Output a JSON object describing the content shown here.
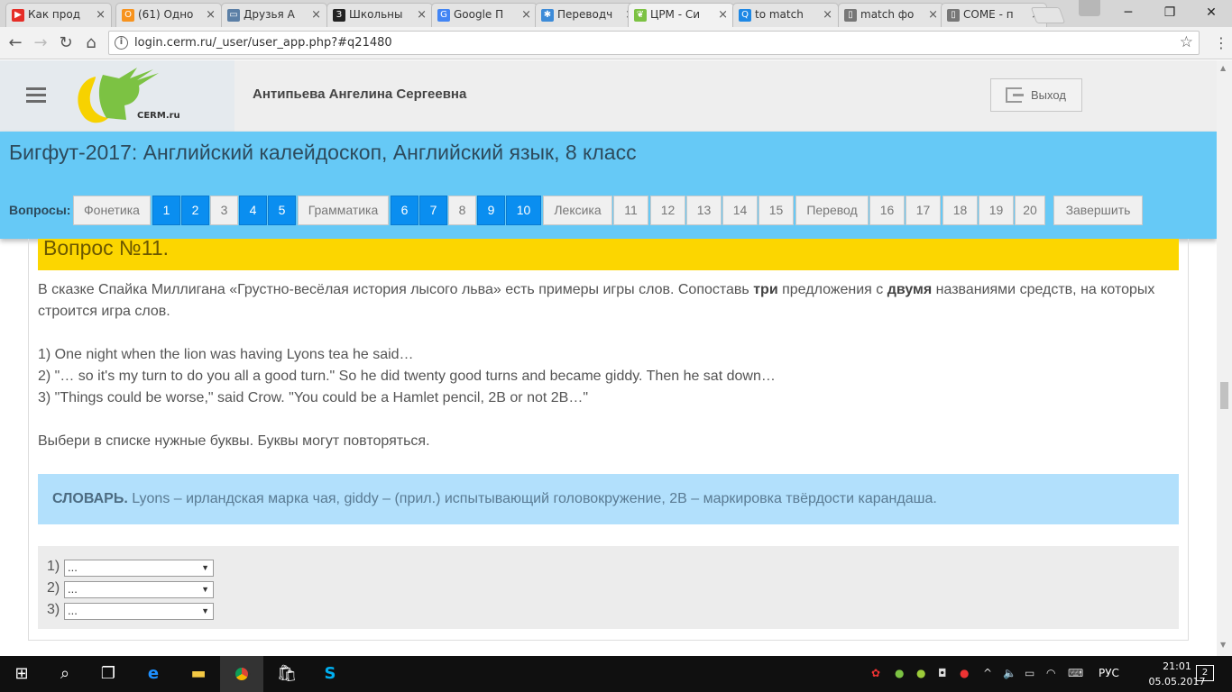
{
  "browser": {
    "tabs": [
      {
        "label": "Как прод",
        "icon": "youtube-icon",
        "color": "#e52d27"
      },
      {
        "label": "(61) Одно",
        "icon": "odnoklassniki-icon",
        "color": "#f7931e"
      },
      {
        "label": "Друзья А",
        "icon": "chat-icon",
        "color": "#5b7fa6"
      },
      {
        "label": "Школьны",
        "icon": "book-icon",
        "color": "#222222"
      },
      {
        "label": "Google П",
        "icon": "google-translate-icon",
        "color": "#4285f4"
      },
      {
        "label": "Переводч",
        "icon": "translate-icon",
        "color": "#3d8bd8"
      },
      {
        "label": "ЦРМ - Си",
        "icon": "cerm-icon",
        "color": "#7cc243"
      },
      {
        "label": "to match",
        "icon": "search-icon",
        "color": "#1e88e5"
      },
      {
        "label": "match фо",
        "icon": "document-icon",
        "color": "#777777"
      },
      {
        "label": "COME - п",
        "icon": "document-icon",
        "color": "#777777"
      }
    ],
    "url": "login.cerm.ru/_user/user_app.php?#q21480",
    "window_controls": {
      "minimize": "─",
      "maximize": "❐",
      "close": "✕"
    }
  },
  "header": {
    "logo_text": "CERM.ru",
    "username": "Антипьева Ангелина Сергеевна",
    "logout_label": "Выход"
  },
  "course": {
    "title": "Бигфут-2017: Английский калейдоскоп, Английский язык, 8 класс",
    "questions_label": "Вопросы:",
    "buttons": [
      {
        "label": "Фонетика",
        "done": false
      },
      {
        "label": "1",
        "done": true
      },
      {
        "label": "2",
        "done": true
      },
      {
        "label": "3",
        "done": false
      },
      {
        "label": "4",
        "done": true
      },
      {
        "label": "5",
        "done": true
      },
      {
        "label": "Грамматика",
        "done": false
      },
      {
        "label": "6",
        "done": true
      },
      {
        "label": "7",
        "done": true
      },
      {
        "label": "8",
        "done": false
      },
      {
        "label": "9",
        "done": true
      },
      {
        "label": "10",
        "done": true
      },
      {
        "label": "Лексика",
        "done": false
      },
      {
        "label": "11",
        "done": false
      },
      {
        "label": "12",
        "done": false
      },
      {
        "label": "13",
        "done": false
      },
      {
        "label": "14",
        "done": false
      },
      {
        "label": "15",
        "done": false
      },
      {
        "label": "Перевод",
        "done": false
      },
      {
        "label": "16",
        "done": false
      },
      {
        "label": "17",
        "done": false
      },
      {
        "label": "18",
        "done": false
      },
      {
        "label": "19",
        "done": false
      },
      {
        "label": "20",
        "done": false
      },
      {
        "label": "Завершить",
        "done": false
      }
    ]
  },
  "question": {
    "title": "Вопрос №11.",
    "intro_part1": "В сказке Спайка Миллигана «Грустно-весёлая история лысого льва» есть примеры игры слов. Сопоставь ",
    "intro_bold1": "три",
    "intro_part2": " предложения с ",
    "intro_bold2": "двумя",
    "intro_part3": " названиями средств, на которых строится игра слов.",
    "sentences": [
      "1) One night when the lion was having Lyons tea he said…",
      "2) \"… so it's my turn to do you all a good turn.\" So he did twenty good turns and became giddy. Then he sat down…",
      "3) \"Things could be worse,\" said Crow. \"You could be a Hamlet pencil, 2B or not 2B…\""
    ],
    "instruction": "Выбери в списке нужные буквы. Буквы могут повторяться.",
    "dictionary_label": "СЛОВАРЬ.",
    "dictionary_text": " Lyons – ирландская марка чая, giddy – (прил.) испытывающий головокружение, 2B – маркировка твёрдости карандаша.",
    "answers": [
      {
        "label": "1)",
        "value": "..."
      },
      {
        "label": "2)",
        "value": "..."
      },
      {
        "label": "3)",
        "value": "..."
      }
    ]
  },
  "taskbar": {
    "language": "РУС",
    "time": "21:01",
    "date": "05.05.2017",
    "notifications": "2"
  },
  "colors": {
    "accent_blue": "#66c9f6",
    "done_blue": "#0a8ef0",
    "title_yellow": "#fcd600",
    "dictionary_bg": "#b2e0fc"
  }
}
